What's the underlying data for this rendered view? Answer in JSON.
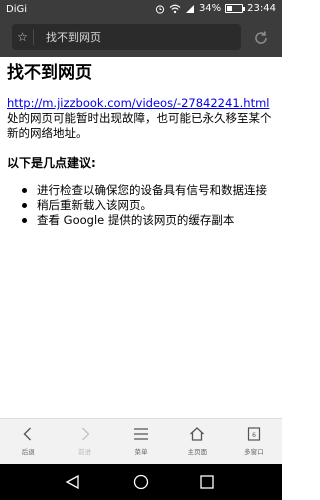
{
  "status_bar": {
    "carrier": "DiGi",
    "battery_percent": "34%",
    "battery_level": 0.34,
    "time": "23:44",
    "icons": [
      "alarm-icon",
      "wifi-icon",
      "signal-icon",
      "battery-icon"
    ]
  },
  "browser": {
    "url_bar_text": "找不到网页",
    "bookmark_icon": "star-icon",
    "refresh_icon": "refresh-icon"
  },
  "page": {
    "title": "找不到网页",
    "url": "http://m.jizzbook.com/videos/-27842241.html",
    "description": "处的网页可能暂时出现故障，也可能已永久移至某个新的网络地址。",
    "suggestions_title": "以下是几点建议:",
    "suggestions": [
      "进行检查以确保您的设备具有信号和数据连接",
      "稍后重新载入该网页。",
      "查看 Google 提供的该网页的缓存副本"
    ]
  },
  "toolbar": {
    "items": [
      {
        "label": "后退",
        "icon": "back-icon",
        "enabled": true
      },
      {
        "label": "前进",
        "icon": "forward-icon",
        "enabled": false
      },
      {
        "label": "菜单",
        "icon": "menu-icon",
        "enabled": true
      },
      {
        "label": "主页面",
        "icon": "home-icon",
        "enabled": true
      },
      {
        "label": "多窗口",
        "icon": "tabs-icon",
        "enabled": true
      }
    ]
  },
  "nav_bar": {
    "icons": [
      "nav-back-icon",
      "nav-home-icon",
      "nav-recents-icon"
    ]
  }
}
